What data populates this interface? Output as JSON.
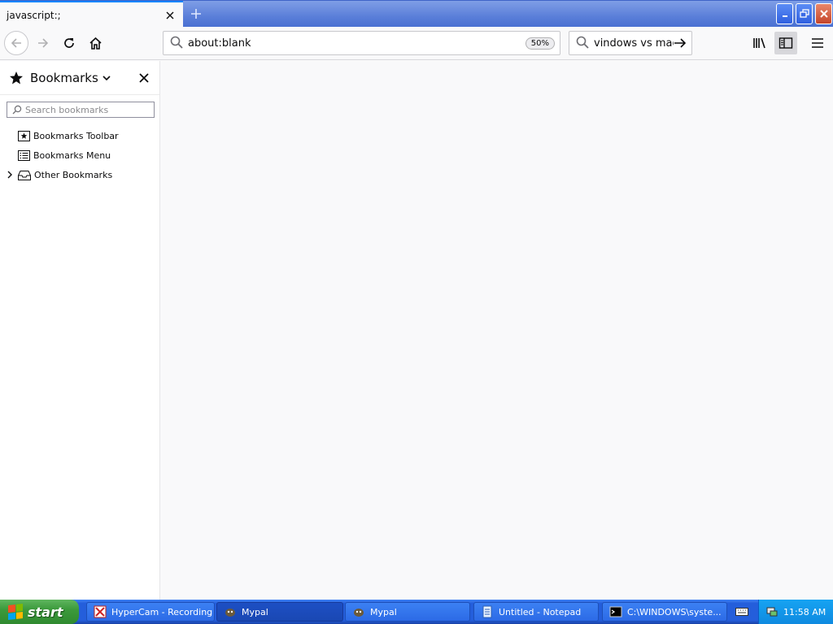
{
  "tab": {
    "title": "javascript:;"
  },
  "nav": {
    "url": "about:blank",
    "zoom": "50%",
    "search_query": "vindows vs mac"
  },
  "sidebar": {
    "title": "Bookmarks",
    "search_placeholder": "Search bookmarks",
    "items": [
      {
        "label": "Bookmarks Toolbar",
        "icon": "bookmarks-toolbar-icon"
      },
      {
        "label": "Bookmarks Menu",
        "icon": "bookmarks-menu-icon"
      },
      {
        "label": "Other Bookmarks",
        "icon": "other-bookmarks-icon"
      }
    ]
  },
  "taskbar": {
    "start_label": "start",
    "tasks": [
      {
        "label": "HyperCam - Recording",
        "icon": "hypercam-icon"
      },
      {
        "label": "Mypal",
        "icon": "mypal-icon"
      },
      {
        "label": "Mypal",
        "icon": "mypal-icon"
      },
      {
        "label": "Untitled - Notepad",
        "icon": "notepad-icon"
      },
      {
        "label": "C:\\WINDOWS\\syste...",
        "icon": "cmd-icon"
      }
    ],
    "clock": "11:58 AM"
  },
  "colors": {
    "accent": "#0a84ff",
    "taskbar": "#245edb",
    "start": "#3c9a3c",
    "tray": "#0f8ae0",
    "close_button": "#c5452a"
  }
}
